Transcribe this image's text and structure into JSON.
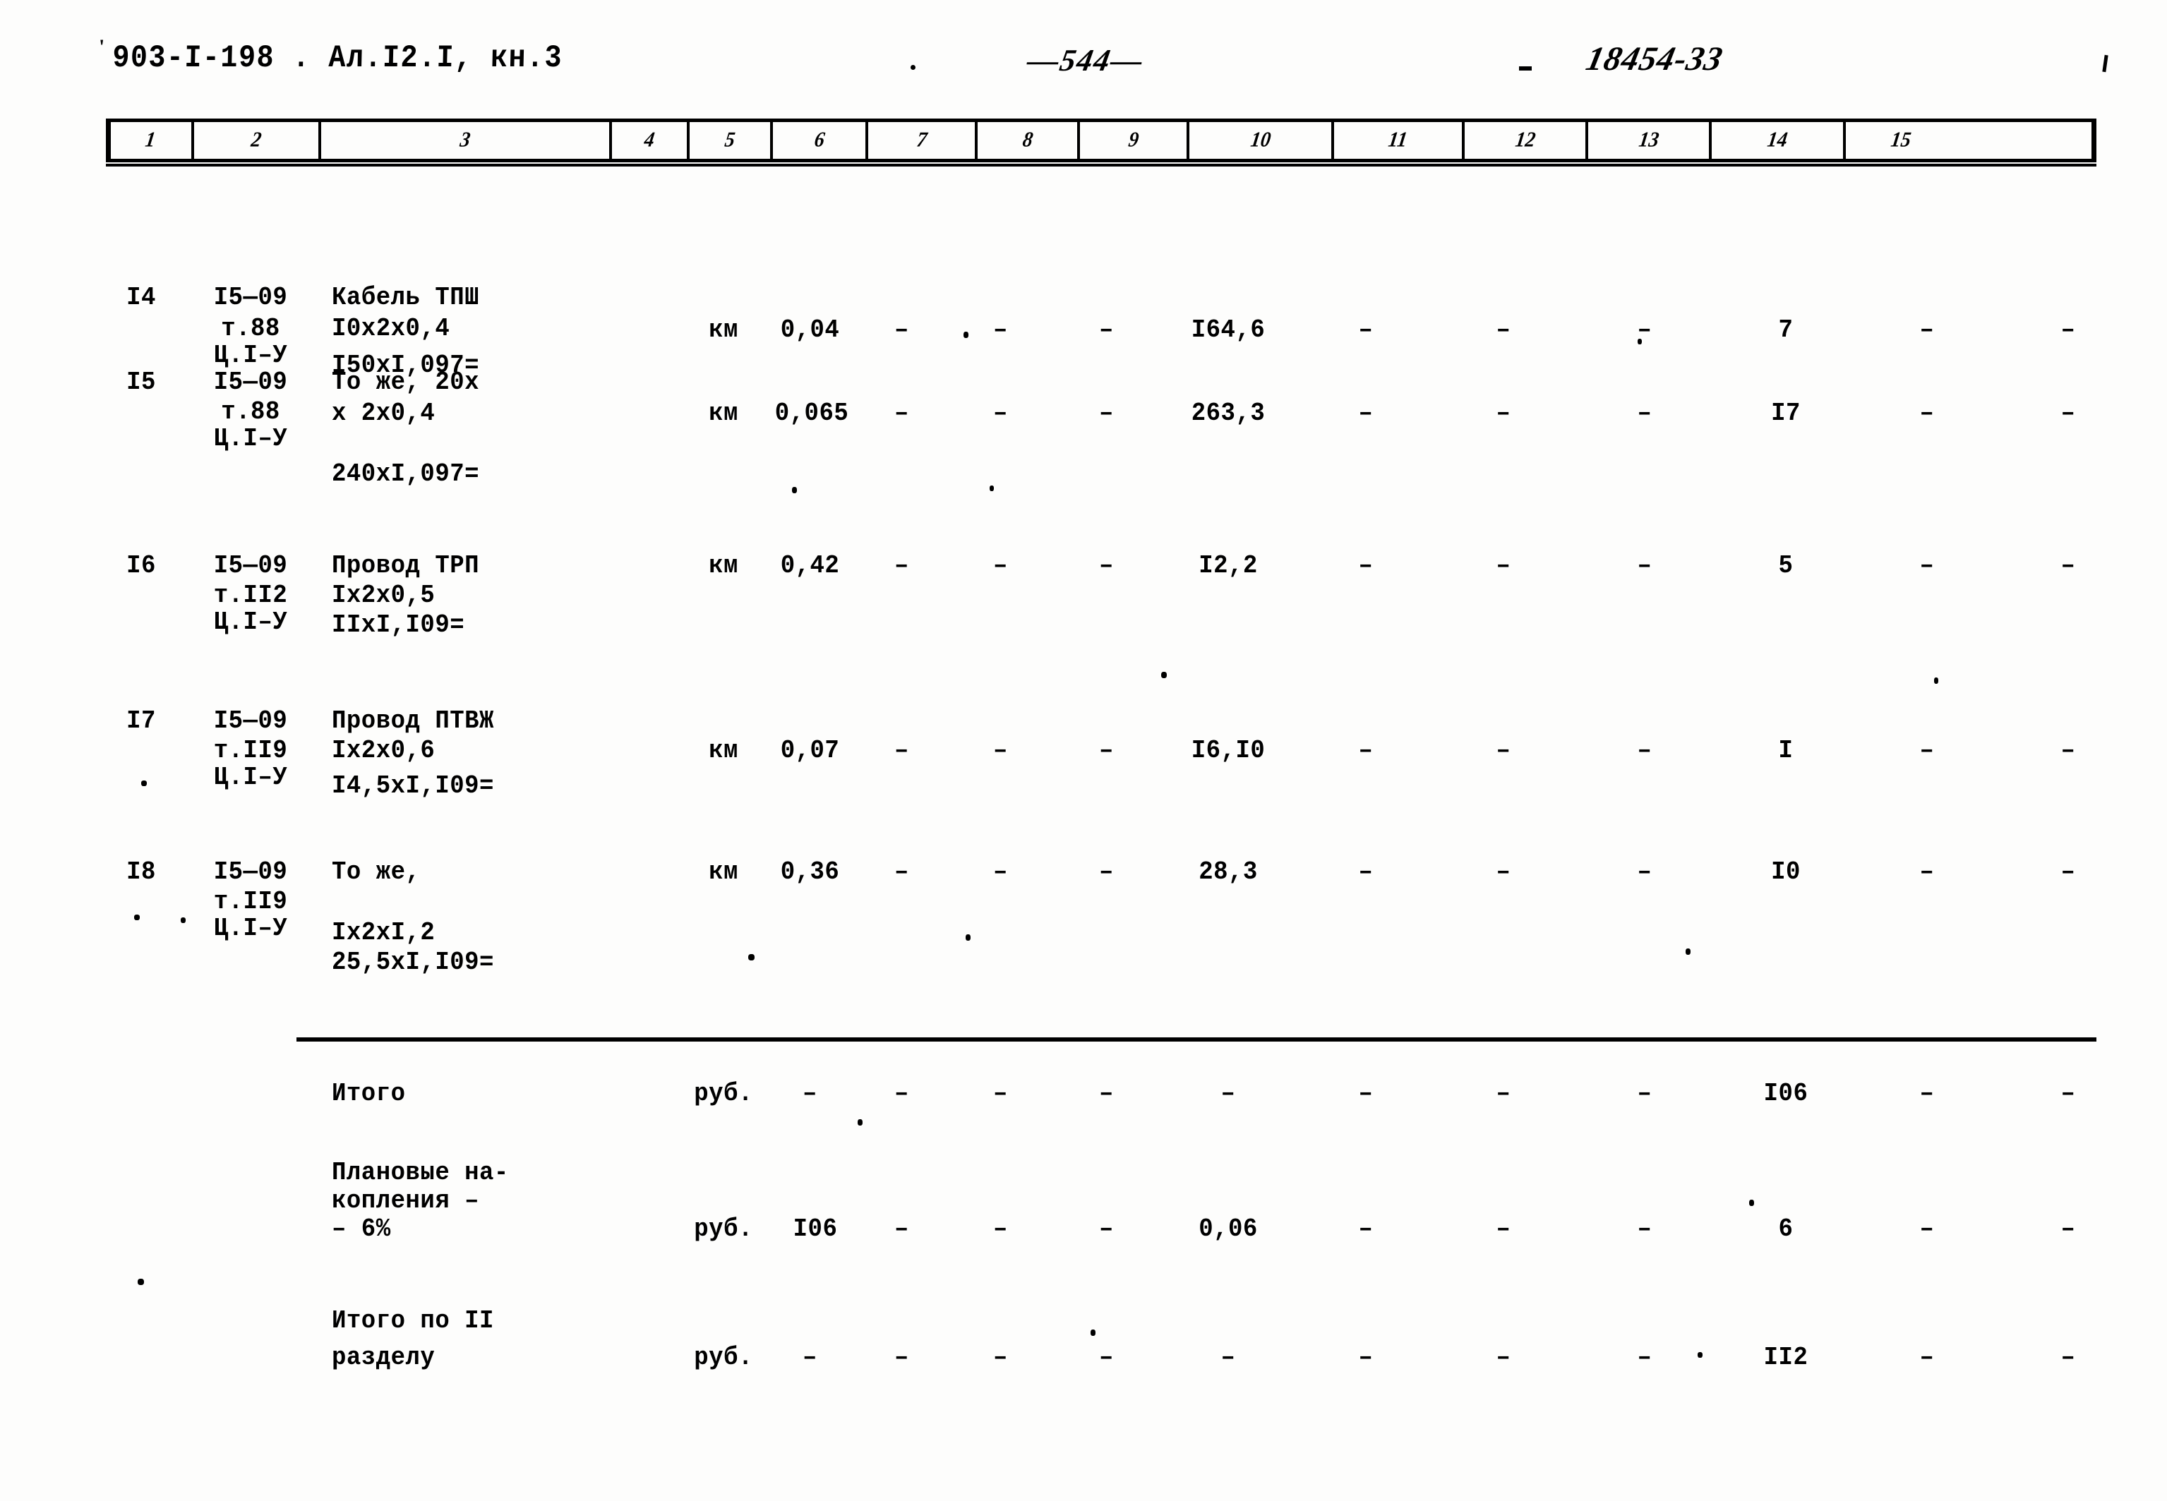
{
  "document": {
    "code": "903-I-198 . Ал.I2.I, кн.3",
    "page_number": "—544—",
    "stamp_number": "18454-33"
  },
  "table": {
    "column_numbers": [
      "1",
      "2",
      "3",
      "4",
      "5",
      "6",
      "7",
      "8",
      "9",
      "10",
      "11",
      "12",
      "13",
      "14",
      "15"
    ],
    "rows": [
      {
        "num": "I4",
        "ref": [
          "I5—09",
          "т.88",
          "Ц.I–У"
        ],
        "name": [
          "Кабель ТПШ",
          "I0х2х0,4",
          "I50хI,097="
        ],
        "unit": "км",
        "c5": "0,04",
        "c6": "–",
        "c7": "–",
        "c8": "–",
        "c9": "I64,6",
        "c10": "–",
        "c11": "–",
        "c12": "–",
        "c13": "7",
        "c14": "–",
        "c15": "–"
      },
      {
        "num": "I5",
        "ref": [
          "I5—09",
          "т.88",
          "Ц.I–У"
        ],
        "name": [
          "То же, 20х",
          "х 2х0,4",
          "",
          "240хI,097="
        ],
        "unit": "км",
        "c5": "0,065",
        "c6": "–",
        "c7": "–",
        "c8": "–",
        "c9": "263,3",
        "c10": "–",
        "c11": "–",
        "c12": "–",
        "c13": "I7",
        "c14": "–",
        "c15": "–"
      },
      {
        "num": "I6",
        "ref": [
          "I5—09",
          "т.II2",
          "Ц.I–У"
        ],
        "name": [
          "Провод ТРП",
          "Iх2х0,5",
          "IIхI,I09="
        ],
        "unit": "км",
        "c5": "0,42",
        "c6": "–",
        "c7": "–",
        "c8": "–",
        "c9": "I2,2",
        "c10": "–",
        "c11": "–",
        "c12": "–",
        "c13": "5",
        "c14": "–",
        "c15": "–"
      },
      {
        "num": "I7",
        "ref": [
          "I5—09",
          "т.II9",
          "Ц.I–У"
        ],
        "name": [
          "Провод ПТВЖ",
          "Iх2х0,6",
          "I4,5хI,I09="
        ],
        "unit": "км",
        "c5": "0,07",
        "c6": "–",
        "c7": "–",
        "c8": "–",
        "c9": "I6,I0",
        "c10": "–",
        "c11": "–",
        "c12": "–",
        "c13": "I",
        "c14": "–",
        "c15": "–"
      },
      {
        "num": "I8",
        "ref": [
          "I5—09",
          "т.II9",
          "Ц.I–У"
        ],
        "name": [
          "То же,",
          "",
          "Iх2хI,2",
          "25,5хI,I09="
        ],
        "unit": "км",
        "c5": "0,36",
        "c6": "–",
        "c7": "–",
        "c8": "–",
        "c9": "28,3",
        "c10": "–",
        "c11": "–",
        "c12": "–",
        "c13": "I0",
        "c14": "–",
        "c15": "–"
      }
    ],
    "totals": [
      {
        "label": [
          "Итого"
        ],
        "unit": "руб.",
        "c5": "–",
        "c6": "–",
        "c7": "–",
        "c8": "–",
        "c9": "–",
        "c10": "–",
        "c11": "–",
        "c12": "–",
        "c13": "I06",
        "c14": "–",
        "c15": "–"
      },
      {
        "label": [
          "Плановые на-",
          "копления –",
          "– 6%"
        ],
        "unit": "руб.",
        "c5": "I06",
        "c6": "–",
        "c7": "–",
        "c8": "–",
        "c9": "0,06",
        "c10": "–",
        "c11": "–",
        "c12": "–",
        "c13": "6",
        "c14": "–",
        "c15": "–"
      },
      {
        "label": [
          "Итого по II",
          "разделу"
        ],
        "unit": "руб.",
        "c5": "–",
        "c6": "–",
        "c7": "–",
        "c8": "–",
        "c9": "–",
        "c10": "–",
        "c11": "–",
        "c12": "–",
        "c13": "II2",
        "c14": "–",
        "c15": "–"
      }
    ]
  }
}
